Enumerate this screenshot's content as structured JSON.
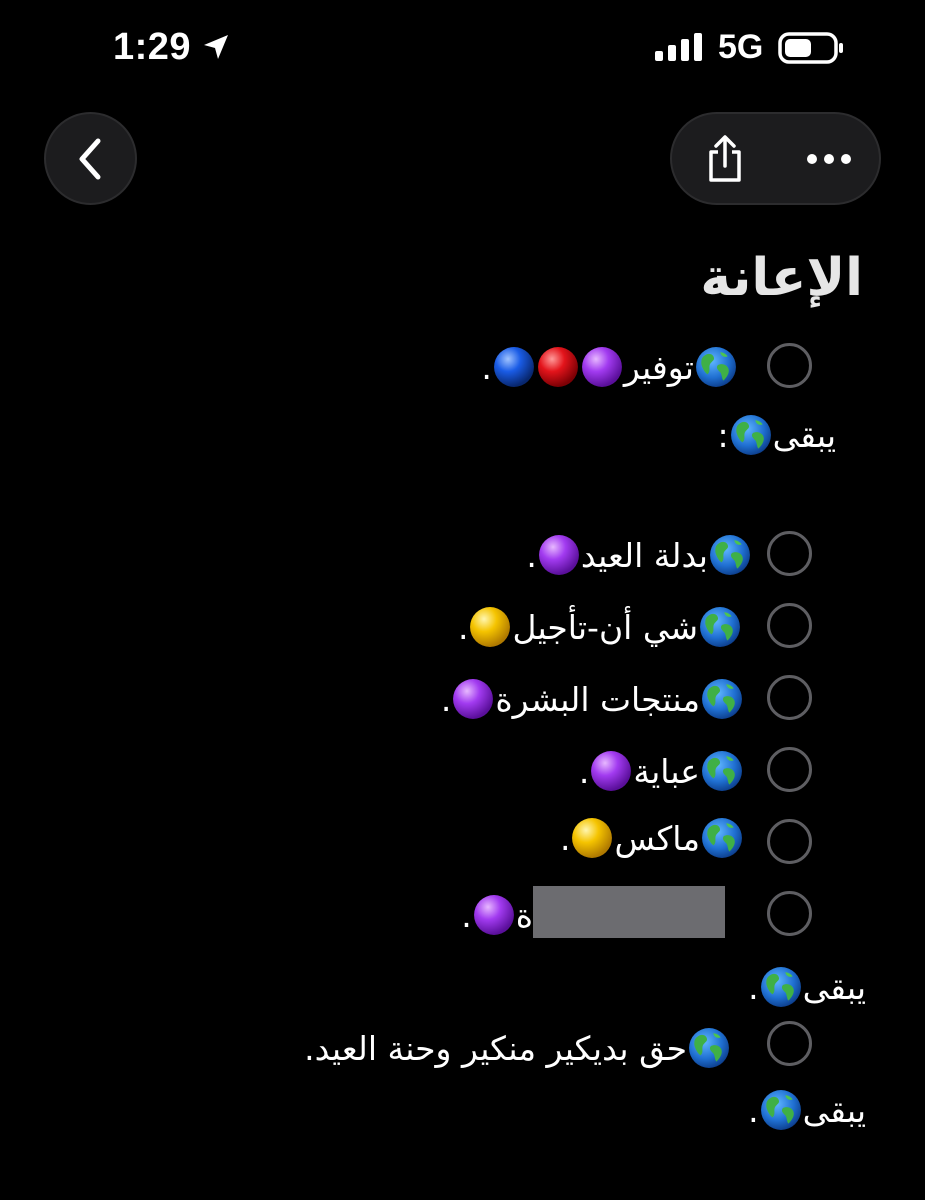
{
  "status_bar": {
    "time": "1:29",
    "network": "5G",
    "icons": [
      "location-arrow-icon",
      "signal-bars-icon",
      "battery-icon"
    ]
  },
  "nav": {
    "icons": [
      "chevron-left-icon",
      "share-icon",
      "ellipsis-icon"
    ]
  },
  "note": {
    "title": "الإعانة",
    "items": [
      {
        "type": "check",
        "text": "توفير",
        "end": "."
      },
      {
        "type": "text",
        "text": "يبقى",
        "end": ":"
      },
      {
        "type": "check",
        "text": "بدلة العيد",
        "end": "."
      },
      {
        "type": "check",
        "text": "شي أن-تأجيل",
        "end": "."
      },
      {
        "type": "check",
        "text": "منتجات البشرة",
        "end": "."
      },
      {
        "type": "check",
        "text": "عباية",
        "end": "."
      },
      {
        "type": "check",
        "text": "ماكس",
        "end": "."
      },
      {
        "type": "check",
        "text": "ة",
        "end": "."
      },
      {
        "type": "text",
        "text": "يبقى",
        "end": "."
      },
      {
        "type": "check",
        "text": "حق بديكير منكير وحنة العيد",
        "end": "."
      },
      {
        "type": "text",
        "text": "يبقى",
        "end": "."
      }
    ]
  },
  "colors": {
    "background": "#000000",
    "button_bg": "#1c1c1e",
    "checkbox_border": "#5e5e62",
    "dot_purple": "#a23bf0",
    "dot_red": "#e3141b",
    "dot_blue": "#1a5ce6",
    "dot_yellow": "#f5c400"
  }
}
